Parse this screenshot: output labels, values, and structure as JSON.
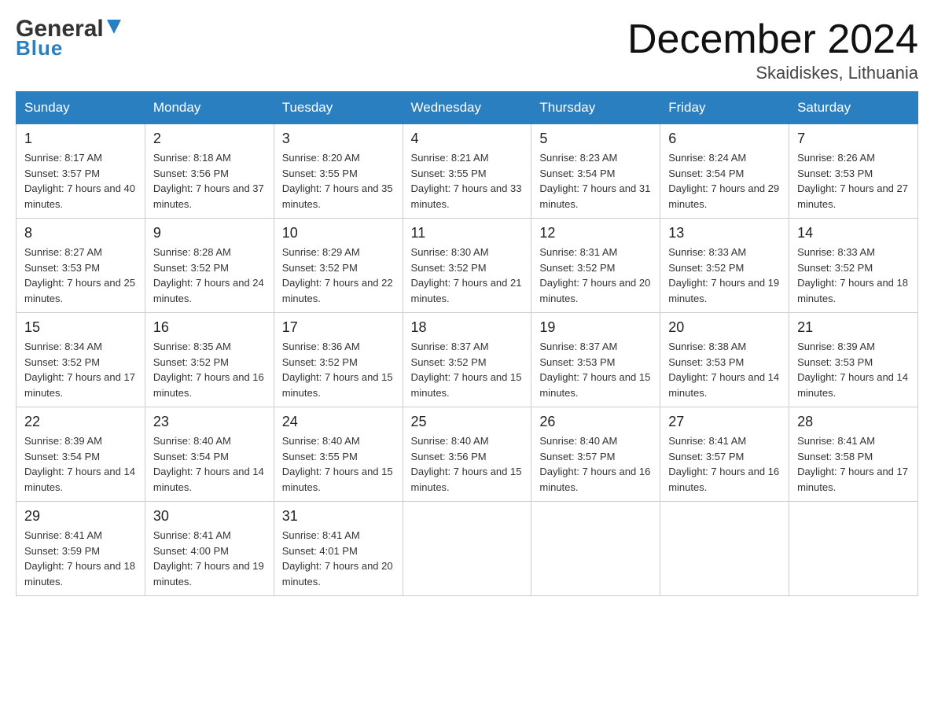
{
  "header": {
    "logo_general": "General",
    "logo_blue": "Blue",
    "title": "December 2024",
    "subtitle": "Skaidiskes, Lithuania"
  },
  "days_of_week": [
    "Sunday",
    "Monday",
    "Tuesday",
    "Wednesday",
    "Thursday",
    "Friday",
    "Saturday"
  ],
  "weeks": [
    [
      {
        "day": "1",
        "sunrise": "8:17 AM",
        "sunset": "3:57 PM",
        "daylight": "7 hours and 40 minutes."
      },
      {
        "day": "2",
        "sunrise": "8:18 AM",
        "sunset": "3:56 PM",
        "daylight": "7 hours and 37 minutes."
      },
      {
        "day": "3",
        "sunrise": "8:20 AM",
        "sunset": "3:55 PM",
        "daylight": "7 hours and 35 minutes."
      },
      {
        "day": "4",
        "sunrise": "8:21 AM",
        "sunset": "3:55 PM",
        "daylight": "7 hours and 33 minutes."
      },
      {
        "day": "5",
        "sunrise": "8:23 AM",
        "sunset": "3:54 PM",
        "daylight": "7 hours and 31 minutes."
      },
      {
        "day": "6",
        "sunrise": "8:24 AM",
        "sunset": "3:54 PM",
        "daylight": "7 hours and 29 minutes."
      },
      {
        "day": "7",
        "sunrise": "8:26 AM",
        "sunset": "3:53 PM",
        "daylight": "7 hours and 27 minutes."
      }
    ],
    [
      {
        "day": "8",
        "sunrise": "8:27 AM",
        "sunset": "3:53 PM",
        "daylight": "7 hours and 25 minutes."
      },
      {
        "day": "9",
        "sunrise": "8:28 AM",
        "sunset": "3:52 PM",
        "daylight": "7 hours and 24 minutes."
      },
      {
        "day": "10",
        "sunrise": "8:29 AM",
        "sunset": "3:52 PM",
        "daylight": "7 hours and 22 minutes."
      },
      {
        "day": "11",
        "sunrise": "8:30 AM",
        "sunset": "3:52 PM",
        "daylight": "7 hours and 21 minutes."
      },
      {
        "day": "12",
        "sunrise": "8:31 AM",
        "sunset": "3:52 PM",
        "daylight": "7 hours and 20 minutes."
      },
      {
        "day": "13",
        "sunrise": "8:33 AM",
        "sunset": "3:52 PM",
        "daylight": "7 hours and 19 minutes."
      },
      {
        "day": "14",
        "sunrise": "8:33 AM",
        "sunset": "3:52 PM",
        "daylight": "7 hours and 18 minutes."
      }
    ],
    [
      {
        "day": "15",
        "sunrise": "8:34 AM",
        "sunset": "3:52 PM",
        "daylight": "7 hours and 17 minutes."
      },
      {
        "day": "16",
        "sunrise": "8:35 AM",
        "sunset": "3:52 PM",
        "daylight": "7 hours and 16 minutes."
      },
      {
        "day": "17",
        "sunrise": "8:36 AM",
        "sunset": "3:52 PM",
        "daylight": "7 hours and 15 minutes."
      },
      {
        "day": "18",
        "sunrise": "8:37 AM",
        "sunset": "3:52 PM",
        "daylight": "7 hours and 15 minutes."
      },
      {
        "day": "19",
        "sunrise": "8:37 AM",
        "sunset": "3:53 PM",
        "daylight": "7 hours and 15 minutes."
      },
      {
        "day": "20",
        "sunrise": "8:38 AM",
        "sunset": "3:53 PM",
        "daylight": "7 hours and 14 minutes."
      },
      {
        "day": "21",
        "sunrise": "8:39 AM",
        "sunset": "3:53 PM",
        "daylight": "7 hours and 14 minutes."
      }
    ],
    [
      {
        "day": "22",
        "sunrise": "8:39 AM",
        "sunset": "3:54 PM",
        "daylight": "7 hours and 14 minutes."
      },
      {
        "day": "23",
        "sunrise": "8:40 AM",
        "sunset": "3:54 PM",
        "daylight": "7 hours and 14 minutes."
      },
      {
        "day": "24",
        "sunrise": "8:40 AM",
        "sunset": "3:55 PM",
        "daylight": "7 hours and 15 minutes."
      },
      {
        "day": "25",
        "sunrise": "8:40 AM",
        "sunset": "3:56 PM",
        "daylight": "7 hours and 15 minutes."
      },
      {
        "day": "26",
        "sunrise": "8:40 AM",
        "sunset": "3:57 PM",
        "daylight": "7 hours and 16 minutes."
      },
      {
        "day": "27",
        "sunrise": "8:41 AM",
        "sunset": "3:57 PM",
        "daylight": "7 hours and 16 minutes."
      },
      {
        "day": "28",
        "sunrise": "8:41 AM",
        "sunset": "3:58 PM",
        "daylight": "7 hours and 17 minutes."
      }
    ],
    [
      {
        "day": "29",
        "sunrise": "8:41 AM",
        "sunset": "3:59 PM",
        "daylight": "7 hours and 18 minutes."
      },
      {
        "day": "30",
        "sunrise": "8:41 AM",
        "sunset": "4:00 PM",
        "daylight": "7 hours and 19 minutes."
      },
      {
        "day": "31",
        "sunrise": "8:41 AM",
        "sunset": "4:01 PM",
        "daylight": "7 hours and 20 minutes."
      },
      null,
      null,
      null,
      null
    ]
  ]
}
